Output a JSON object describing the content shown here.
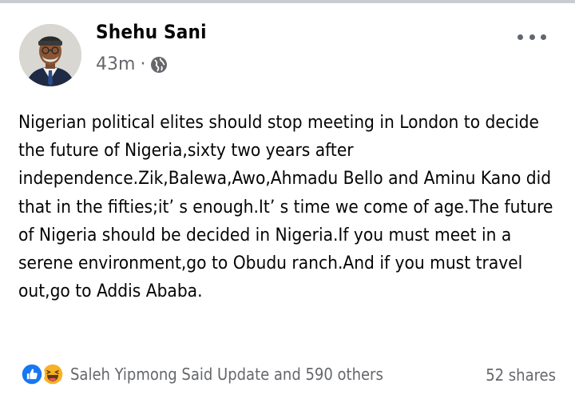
{
  "post": {
    "author": "Shehu Sani",
    "time": "43m",
    "separator": "·",
    "audience_icon": "globe-icon",
    "more_icon": "more-horizontal-icon",
    "text": "Nigerian political elites should stop meeting in London to decide the future of Nigeria,sixty two years after independence.Zik,Balewa,Awo,Ahmadu Bello and Aminu Kano did that in the fifties;it’ s enough.It’ s time we come of age.The future of Nigeria should be decided in Nigeria.If you must meet in a serene environment,go to Obudu ranch.And if you must travel out,go to Addis Ababa."
  },
  "footer": {
    "reaction_icons": [
      "like-icon",
      "haha-icon"
    ],
    "reactions_text": "Saleh Yipmong Said Update and 590 others",
    "shares_text": "52 shares"
  },
  "colors": {
    "like_blue": "#1877f2",
    "haha_yellow": "#f7b125",
    "secondary_text": "#65676b",
    "primary_text": "#050505"
  }
}
